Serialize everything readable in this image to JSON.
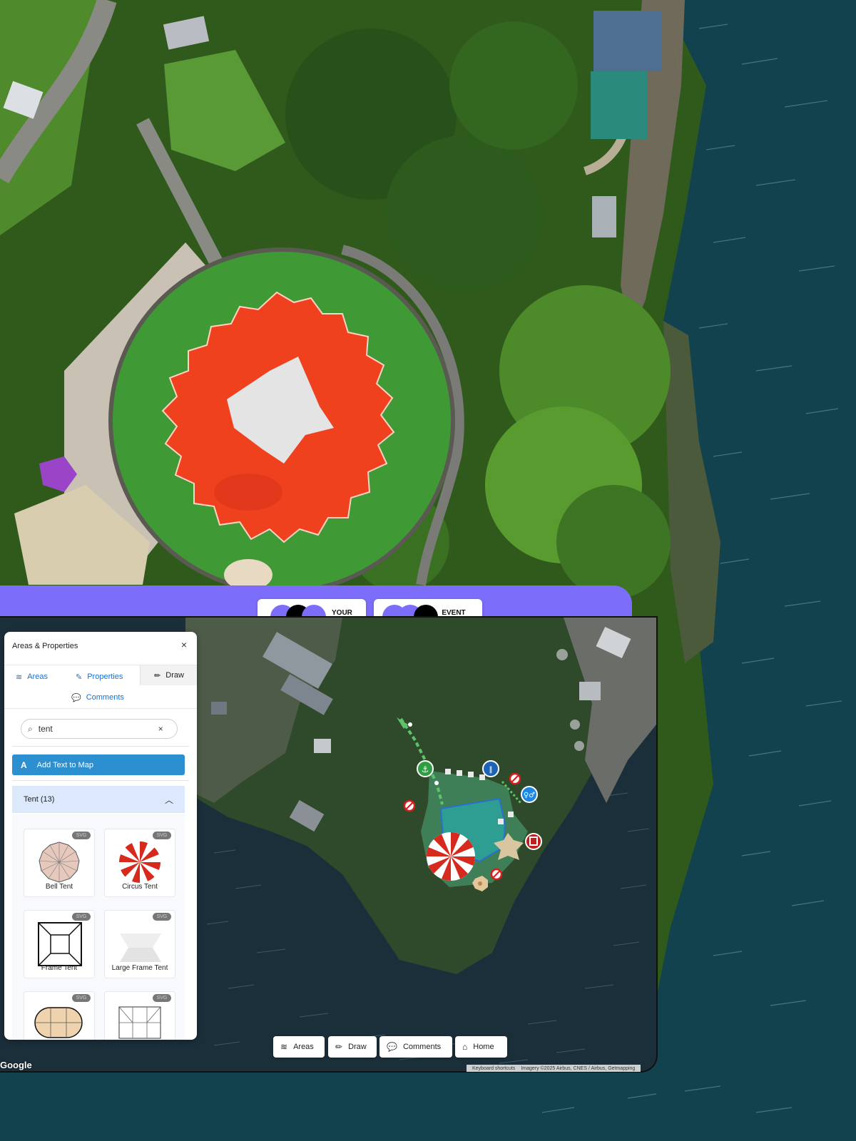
{
  "panel": {
    "title": "Areas & Properties",
    "close": "×",
    "tabs": [
      {
        "label": "Areas",
        "icon": "layers-icon"
      },
      {
        "label": "Properties",
        "icon": "edit-icon"
      },
      {
        "label": "Draw",
        "icon": "pencil-icon",
        "active": true
      },
      {
        "label": "Comments",
        "icon": "comments-icon"
      }
    ],
    "search": {
      "value": "tent",
      "clear": "×"
    },
    "add_text_label": "Add Text to Map",
    "category": {
      "label": "Tent (13)",
      "expanded": true
    },
    "items": [
      {
        "label": "Bell Tent",
        "badge": "SVG"
      },
      {
        "label": "Circus Tent",
        "badge": "SVG"
      },
      {
        "label": "Frame Tent",
        "badge": "SVG"
      },
      {
        "label": "Large Frame Tent",
        "badge": "SVG"
      },
      {
        "label": "",
        "badge": "SVG"
      },
      {
        "label": "",
        "badge": "SVG"
      }
    ]
  },
  "banner": {
    "team": "YOUR\nTEAM",
    "suppliers": "EVENT\nSUPPLIERS"
  },
  "toolbar": [
    {
      "label": "Areas",
      "icon": "layers-icon"
    },
    {
      "label": "Draw",
      "icon": "pencil-icon"
    },
    {
      "label": "Comments",
      "icon": "comments-icon"
    },
    {
      "label": "Home",
      "icon": "home-icon"
    }
  ],
  "map_attribution": {
    "google": "Google",
    "shortcuts": "Keyboard shortcuts",
    "imagery": "Imagery ©2025 Airbus, CNES / Airbus, Getmapping"
  },
  "colors": {
    "accent_purple": "#7d6dfb",
    "primary_blue": "#2b8fd0",
    "category_bg": "#dce8fb",
    "tent_red": "#f0411f"
  }
}
